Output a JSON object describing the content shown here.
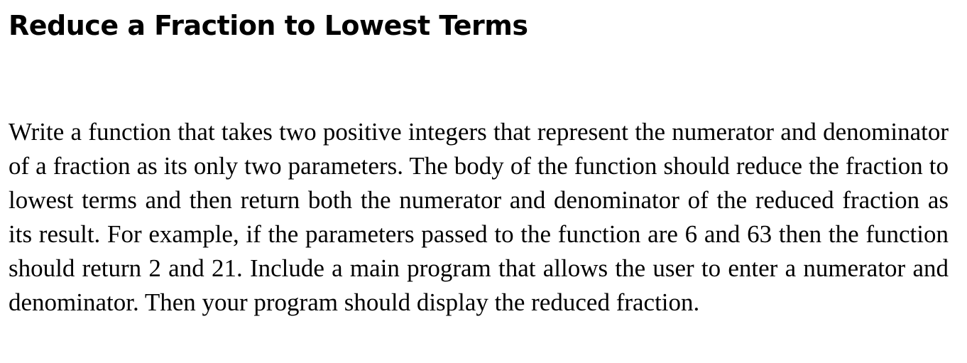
{
  "document": {
    "title": "Reduce a Fraction to Lowest Terms",
    "body": "Write a function that takes two positive integers that represent the numerator and denominator of a fraction as its only two parameters. The body of the function should reduce the fraction to lowest terms and then return both the numerator and denominator of the reduced fraction as its result. For example, if the parameters passed to the function are 6 and 63 then the function should return 2 and 21. Include a main program that allows the user to enter a numerator and denominator. Then your program should display the reduced fraction."
  }
}
